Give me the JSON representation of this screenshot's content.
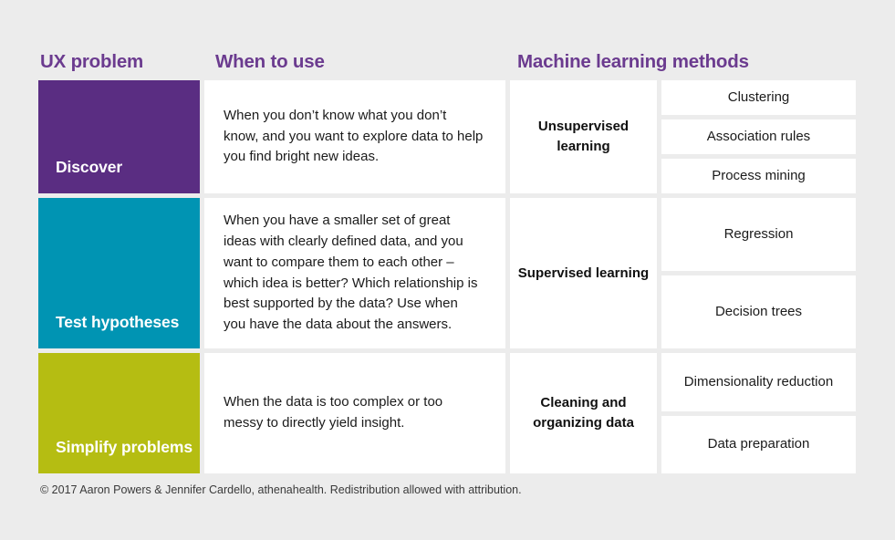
{
  "background_color": "#ececec",
  "headers": {
    "ux_problem": "UX problem",
    "when_to_use": "When to use",
    "machine_learning_methods": "Machine learning methods",
    "color": "#6b3b8f"
  },
  "rows": [
    {
      "problem": "Discover",
      "problem_color": "#5a2d82",
      "when_to_use": "When you don’t know what you don’t know, and you want to explore data to help you find bright new ideas.",
      "family": "Unsupervised learning",
      "methods": [
        "Clustering",
        "Association rules",
        "Process mining"
      ]
    },
    {
      "problem": "Test hypotheses",
      "problem_color": "#0094b3",
      "when_to_use": "When you have a smaller set of great ideas with clearly defined data, and you want to compare them to each other – which idea is better? Which relationship is best supported by the data? Use when you have the data about the answers.",
      "family": "Supervised learning",
      "methods": [
        "Regression",
        "Decision trees"
      ]
    },
    {
      "problem": "Simplify problems",
      "problem_color": "#b5bd12",
      "when_to_use": "When the data is too complex or too messy to directly yield insight.",
      "family": "Cleaning and organizing data",
      "methods": [
        "Dimensionality reduction",
        "Data preparation"
      ]
    }
  ],
  "footer": {
    "credit": "© 2017 Aaron Powers & Jennifer Cardello, athenahealth. Redistribution allowed with attribution."
  }
}
